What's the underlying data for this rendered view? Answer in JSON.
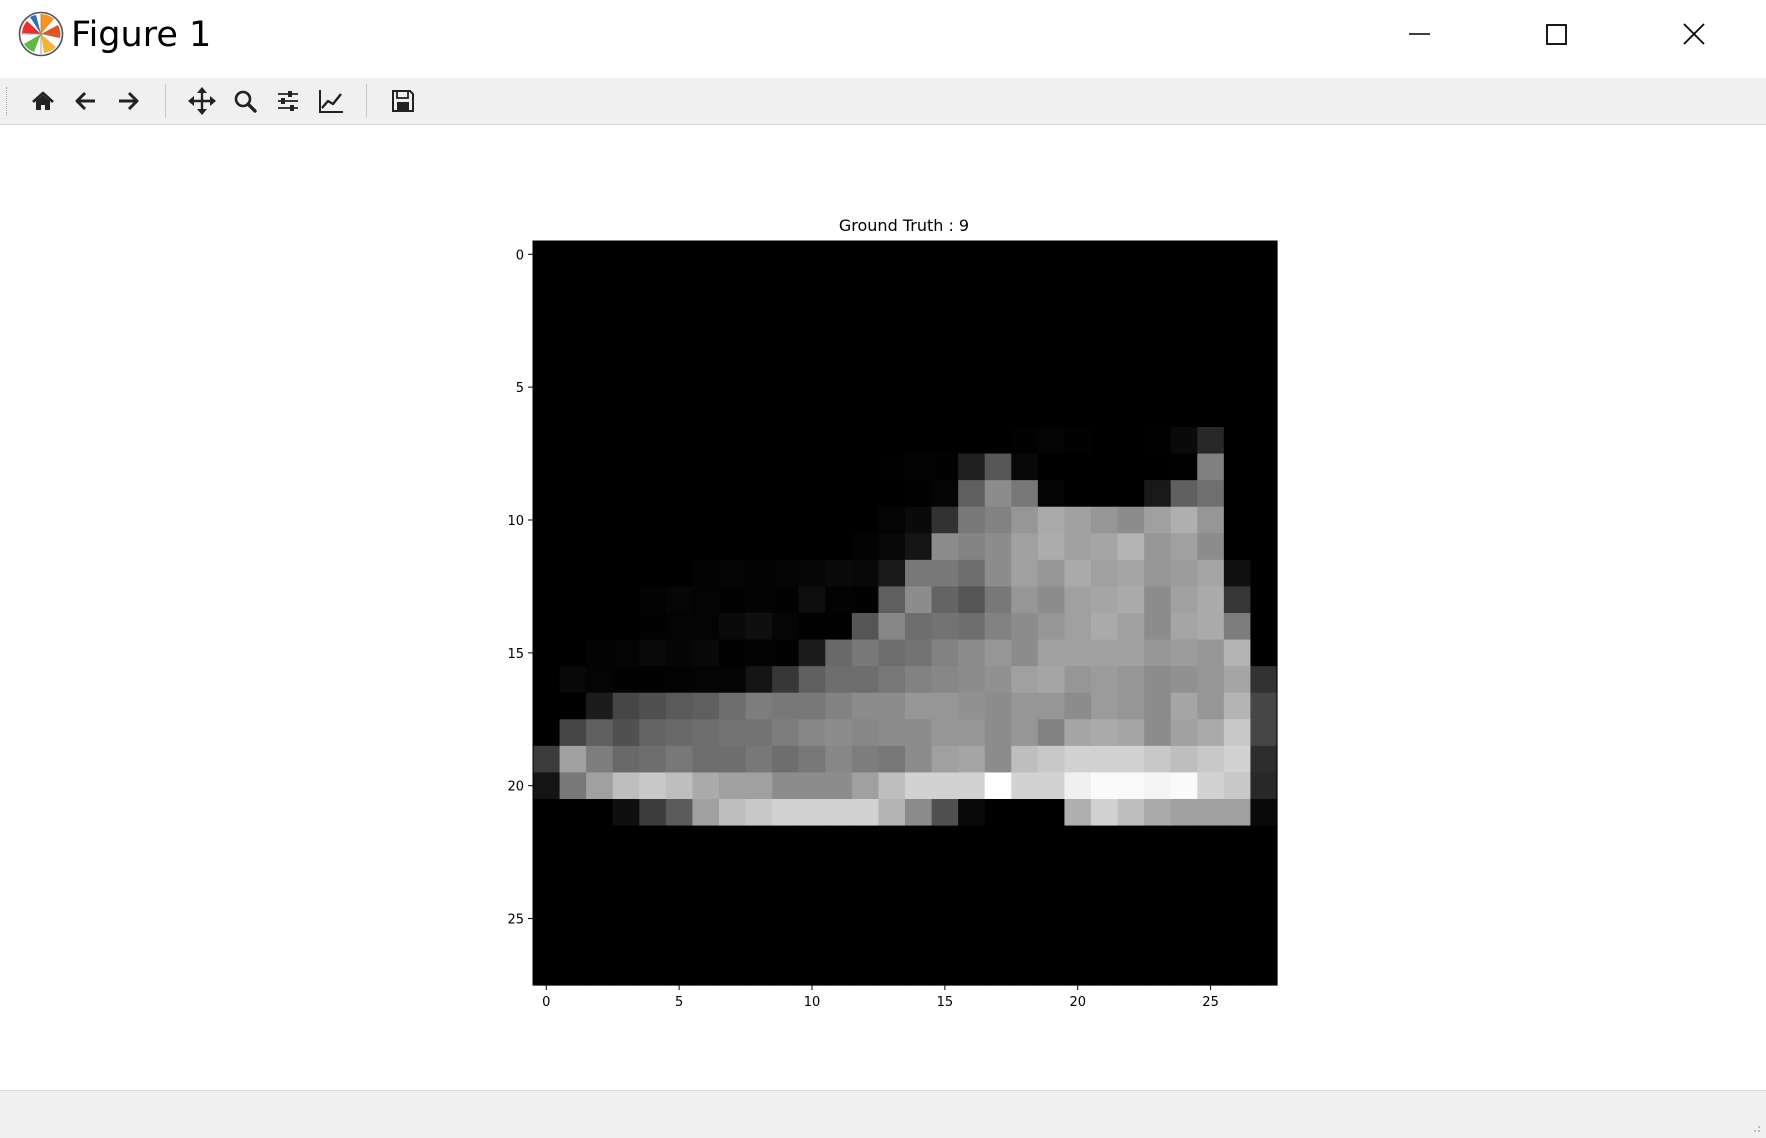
{
  "window": {
    "title": "Figure 1",
    "buttons": [
      "minimize",
      "maximize",
      "close"
    ]
  },
  "toolbar": {
    "items": [
      {
        "icon": "home-icon",
        "tooltip": "Home"
      },
      {
        "icon": "back-arrow-icon",
        "tooltip": "Back"
      },
      {
        "icon": "forward-arrow-icon",
        "tooltip": "Forward"
      },
      {
        "icon": "pan-icon",
        "tooltip": "Pan"
      },
      {
        "icon": "zoom-icon",
        "tooltip": "Zoom"
      },
      {
        "icon": "subplots-config-icon",
        "tooltip": "Subplots"
      },
      {
        "icon": "edit-axis-icon",
        "tooltip": "Customize"
      },
      {
        "icon": "save-icon",
        "tooltip": "Save"
      }
    ]
  },
  "chart_data": {
    "type": "heatmap",
    "title": "Ground Truth : 9",
    "colormap": "gray",
    "xlim": [
      -0.5,
      27.5
    ],
    "ylim": [
      27.5,
      -0.5
    ],
    "xticks": [
      0,
      5,
      10,
      15,
      20,
      25
    ],
    "yticks": [
      0,
      5,
      10,
      15,
      20,
      25
    ],
    "xtick_labels": [
      "0",
      "5",
      "10",
      "15",
      "20",
      "25"
    ],
    "ytick_labels": [
      "0",
      "5",
      "10",
      "15",
      "20",
      "25"
    ],
    "grid": false,
    "pixels": [
      [
        0,
        0,
        0,
        0,
        0,
        0,
        0,
        0,
        0,
        0,
        0,
        0,
        0,
        0,
        0,
        0,
        0,
        0,
        0,
        0,
        0,
        0,
        0,
        0,
        0,
        0,
        0,
        0
      ],
      [
        0,
        0,
        0,
        0,
        0,
        0,
        0,
        0,
        0,
        0,
        0,
        0,
        0,
        0,
        0,
        0,
        0,
        0,
        0,
        0,
        0,
        0,
        0,
        0,
        0,
        0,
        0,
        0
      ],
      [
        0,
        0,
        0,
        0,
        0,
        0,
        0,
        0,
        0,
        0,
        0,
        0,
        0,
        0,
        0,
        0,
        0,
        0,
        0,
        0,
        0,
        0,
        0,
        0,
        0,
        0,
        0,
        0
      ],
      [
        0,
        0,
        0,
        0,
        0,
        0,
        0,
        0,
        0,
        0,
        0,
        0,
        0,
        0,
        0,
        0,
        0,
        0,
        0,
        0,
        0,
        0,
        0,
        0,
        0,
        0,
        0,
        0
      ],
      [
        0,
        0,
        0,
        0,
        0,
        0,
        0,
        0,
        0,
        0,
        0,
        0,
        0,
        0,
        0,
        0,
        0,
        0,
        0,
        0,
        0,
        0,
        0,
        0,
        0,
        0,
        0,
        0
      ],
      [
        0,
        0,
        0,
        0,
        0,
        0,
        0,
        0,
        0,
        0,
        0,
        0,
        0,
        0,
        0,
        0,
        0,
        0,
        0,
        0,
        0,
        0,
        0,
        0,
        0,
        0,
        0,
        0
      ],
      [
        0,
        0,
        0,
        0,
        0,
        0,
        0,
        0,
        0,
        0,
        0,
        0,
        0,
        0,
        0,
        0,
        0,
        0,
        0,
        0,
        0,
        0,
        0,
        0,
        0,
        0,
        0,
        0
      ],
      [
        0,
        0,
        0,
        0,
        0,
        0,
        0,
        0,
        0,
        0,
        0,
        0,
        0,
        0,
        0,
        0,
        0,
        0,
        2,
        4,
        2,
        0,
        0,
        1,
        10,
        40,
        0,
        0
      ],
      [
        0,
        0,
        0,
        0,
        0,
        0,
        0,
        0,
        0,
        0,
        0,
        0,
        0,
        1,
        3,
        2,
        32,
        87,
        8,
        0,
        0,
        0,
        0,
        0,
        1,
        128,
        0,
        0
      ],
      [
        0,
        0,
        0,
        0,
        0,
        0,
        0,
        0,
        0,
        0,
        0,
        0,
        0,
        0,
        1,
        4,
        95,
        140,
        120,
        5,
        0,
        0,
        0,
        25,
        96,
        111,
        0,
        0
      ],
      [
        0,
        0,
        0,
        0,
        0,
        0,
        0,
        0,
        0,
        0,
        0,
        0,
        0,
        4,
        10,
        50,
        120,
        130,
        150,
        170,
        160,
        150,
        140,
        160,
        175,
        150,
        0,
        0
      ],
      [
        0,
        0,
        0,
        0,
        0,
        0,
        0,
        0,
        0,
        0,
        0,
        0,
        3,
        8,
        20,
        140,
        132,
        140,
        160,
        172,
        160,
        165,
        180,
        150,
        160,
        140,
        0,
        0
      ],
      [
        0,
        0,
        0,
        0,
        0,
        0,
        3,
        5,
        3,
        4,
        6,
        10,
        8,
        25,
        120,
        120,
        110,
        140,
        160,
        150,
        170,
        160,
        165,
        150,
        155,
        165,
        16,
        0
      ],
      [
        0,
        0,
        0,
        0,
        3,
        6,
        4,
        2,
        3,
        2,
        14,
        3,
        2,
        95,
        140,
        100,
        85,
        120,
        150,
        140,
        160,
        165,
        170,
        140,
        160,
        170,
        55,
        0
      ],
      [
        0,
        0,
        0,
        0,
        2,
        4,
        4,
        10,
        15,
        6,
        2,
        1,
        85,
        135,
        110,
        115,
        110,
        130,
        140,
        150,
        160,
        170,
        160,
        140,
        165,
        170,
        125,
        0
      ],
      [
        0,
        0,
        3,
        4,
        10,
        5,
        8,
        2,
        3,
        2,
        28,
        105,
        120,
        110,
        115,
        130,
        140,
        150,
        140,
        160,
        160,
        160,
        160,
        150,
        155,
        150,
        180,
        0
      ],
      [
        0,
        8,
        4,
        2,
        2,
        3,
        4,
        4,
        20,
        55,
        95,
        110,
        110,
        120,
        130,
        135,
        140,
        145,
        160,
        165,
        150,
        155,
        150,
        140,
        145,
        150,
        165,
        50
      ],
      [
        0,
        0,
        28,
        70,
        80,
        90,
        95,
        110,
        125,
        120,
        120,
        130,
        140,
        140,
        150,
        150,
        145,
        140,
        150,
        150,
        140,
        155,
        150,
        140,
        165,
        150,
        180,
        70
      ],
      [
        0,
        70,
        95,
        80,
        100,
        105,
        110,
        115,
        115,
        125,
        135,
        140,
        135,
        140,
        140,
        150,
        150,
        140,
        150,
        130,
        165,
        170,
        165,
        140,
        160,
        170,
        200,
        70
      ],
      [
        60,
        160,
        125,
        105,
        110,
        120,
        110,
        110,
        120,
        110,
        120,
        135,
        125,
        120,
        140,
        160,
        165,
        140,
        190,
        200,
        210,
        210,
        210,
        200,
        190,
        200,
        210,
        45
      ],
      [
        20,
        120,
        160,
        190,
        200,
        190,
        170,
        160,
        160,
        140,
        140,
        140,
        160,
        190,
        210,
        210,
        210,
        255,
        210,
        210,
        240,
        250,
        250,
        245,
        250,
        210,
        200,
        40
      ],
      [
        0,
        0,
        0,
        15,
        60,
        90,
        160,
        190,
        200,
        210,
        210,
        210,
        210,
        180,
        140,
        80,
        10,
        0,
        0,
        0,
        175,
        210,
        190,
        170,
        160,
        160,
        160,
        10
      ],
      [
        0,
        0,
        0,
        0,
        0,
        0,
        0,
        0,
        0,
        0,
        0,
        0,
        0,
        0,
        0,
        0,
        0,
        0,
        0,
        0,
        0,
        0,
        0,
        0,
        0,
        0,
        0,
        0
      ],
      [
        0,
        0,
        0,
        0,
        0,
        0,
        0,
        0,
        0,
        0,
        0,
        0,
        0,
        0,
        0,
        0,
        0,
        0,
        0,
        0,
        0,
        0,
        0,
        0,
        0,
        0,
        0,
        0
      ],
      [
        0,
        0,
        0,
        0,
        0,
        0,
        0,
        0,
        0,
        0,
        0,
        0,
        0,
        0,
        0,
        0,
        0,
        0,
        0,
        0,
        0,
        0,
        0,
        0,
        0,
        0,
        0,
        0
      ],
      [
        0,
        0,
        0,
        0,
        0,
        0,
        0,
        0,
        0,
        0,
        0,
        0,
        0,
        0,
        0,
        0,
        0,
        0,
        0,
        0,
        0,
        0,
        0,
        0,
        0,
        0,
        0,
        0
      ],
      [
        0,
        0,
        0,
        0,
        0,
        0,
        0,
        0,
        0,
        0,
        0,
        0,
        0,
        0,
        0,
        0,
        0,
        0,
        0,
        0,
        0,
        0,
        0,
        0,
        0,
        0,
        0,
        0
      ],
      [
        0,
        0,
        0,
        0,
        0,
        0,
        0,
        0,
        0,
        0,
        0,
        0,
        0,
        0,
        0,
        0,
        0,
        0,
        0,
        0,
        0,
        0,
        0,
        0,
        0,
        0,
        0,
        0
      ]
    ]
  }
}
